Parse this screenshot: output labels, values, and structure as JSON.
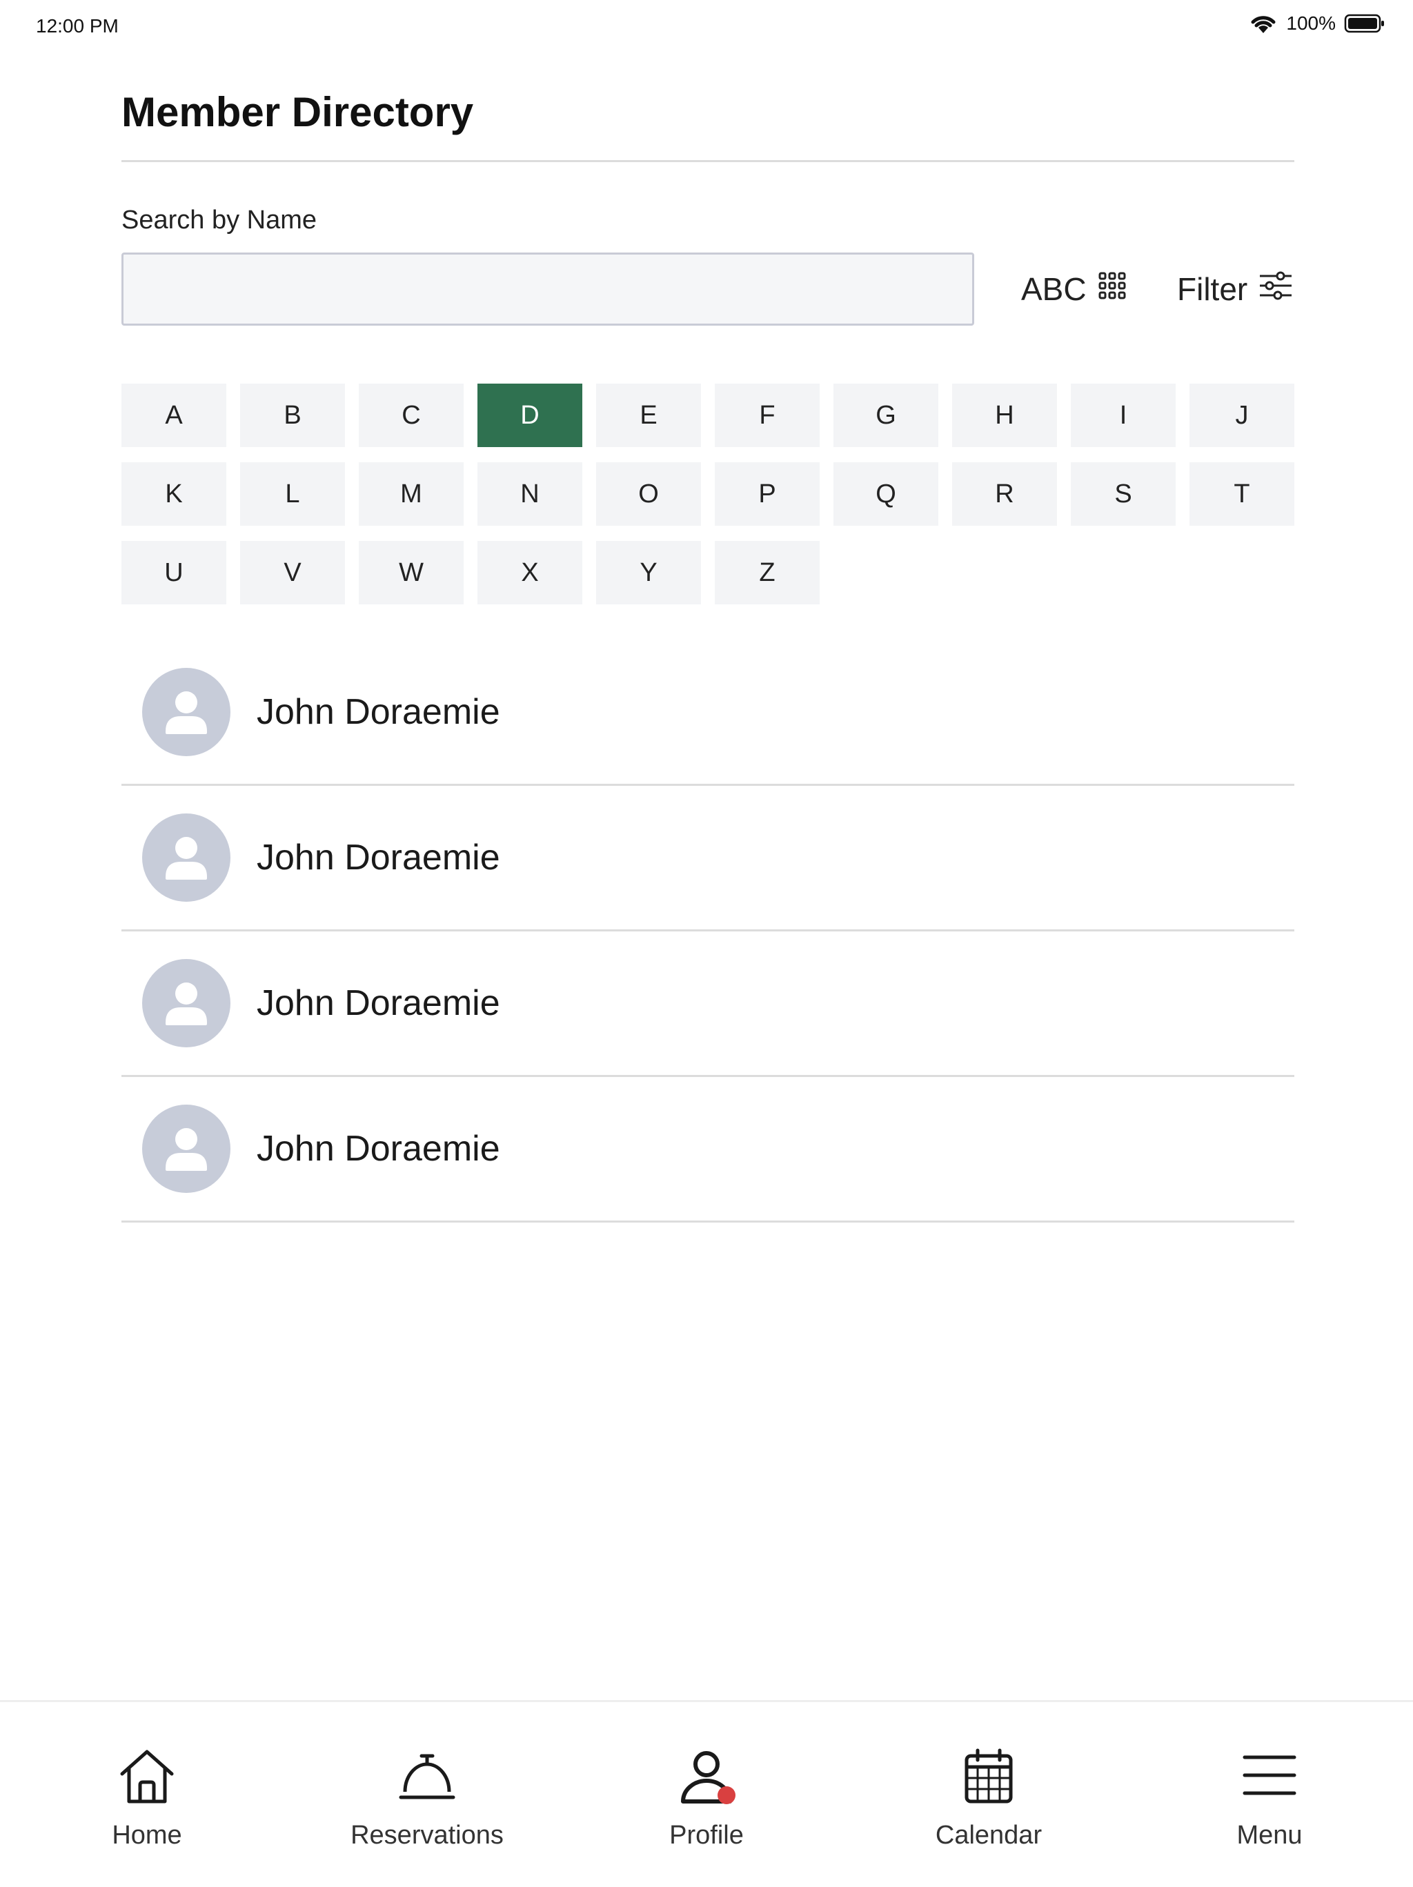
{
  "status_bar": {
    "time": "12:00 PM",
    "battery": "100%"
  },
  "header": {
    "title": "Member Directory"
  },
  "search": {
    "label": "Search by Name",
    "value": "",
    "placeholder": ""
  },
  "toolbar": {
    "abc_label": "ABC",
    "filter_label": "Filter"
  },
  "alphabet": {
    "selected": "D",
    "letters": [
      "A",
      "B",
      "C",
      "D",
      "E",
      "F",
      "G",
      "H",
      "I",
      "J",
      "K",
      "L",
      "M",
      "N",
      "O",
      "P",
      "Q",
      "R",
      "S",
      "T",
      "U",
      "V",
      "W",
      "X",
      "Y",
      "Z"
    ]
  },
  "members": [
    {
      "name": "John Doraemie"
    },
    {
      "name": "John Doraemie"
    },
    {
      "name": "John Doraemie"
    },
    {
      "name": "John Doraemie"
    }
  ],
  "tabs": [
    {
      "label": "Home",
      "icon": "home-icon"
    },
    {
      "label": "Reservations",
      "icon": "service-bell-icon"
    },
    {
      "label": "Profile",
      "icon": "profile-icon",
      "badge": true
    },
    {
      "label": "Calendar",
      "icon": "calendar-icon"
    },
    {
      "label": "Menu",
      "icon": "menu-icon"
    }
  ],
  "colors": {
    "accent": "#2f7150",
    "tile_bg": "#f3f4f6",
    "avatar_bg": "#c7ccd9",
    "badge": "#d94040"
  }
}
